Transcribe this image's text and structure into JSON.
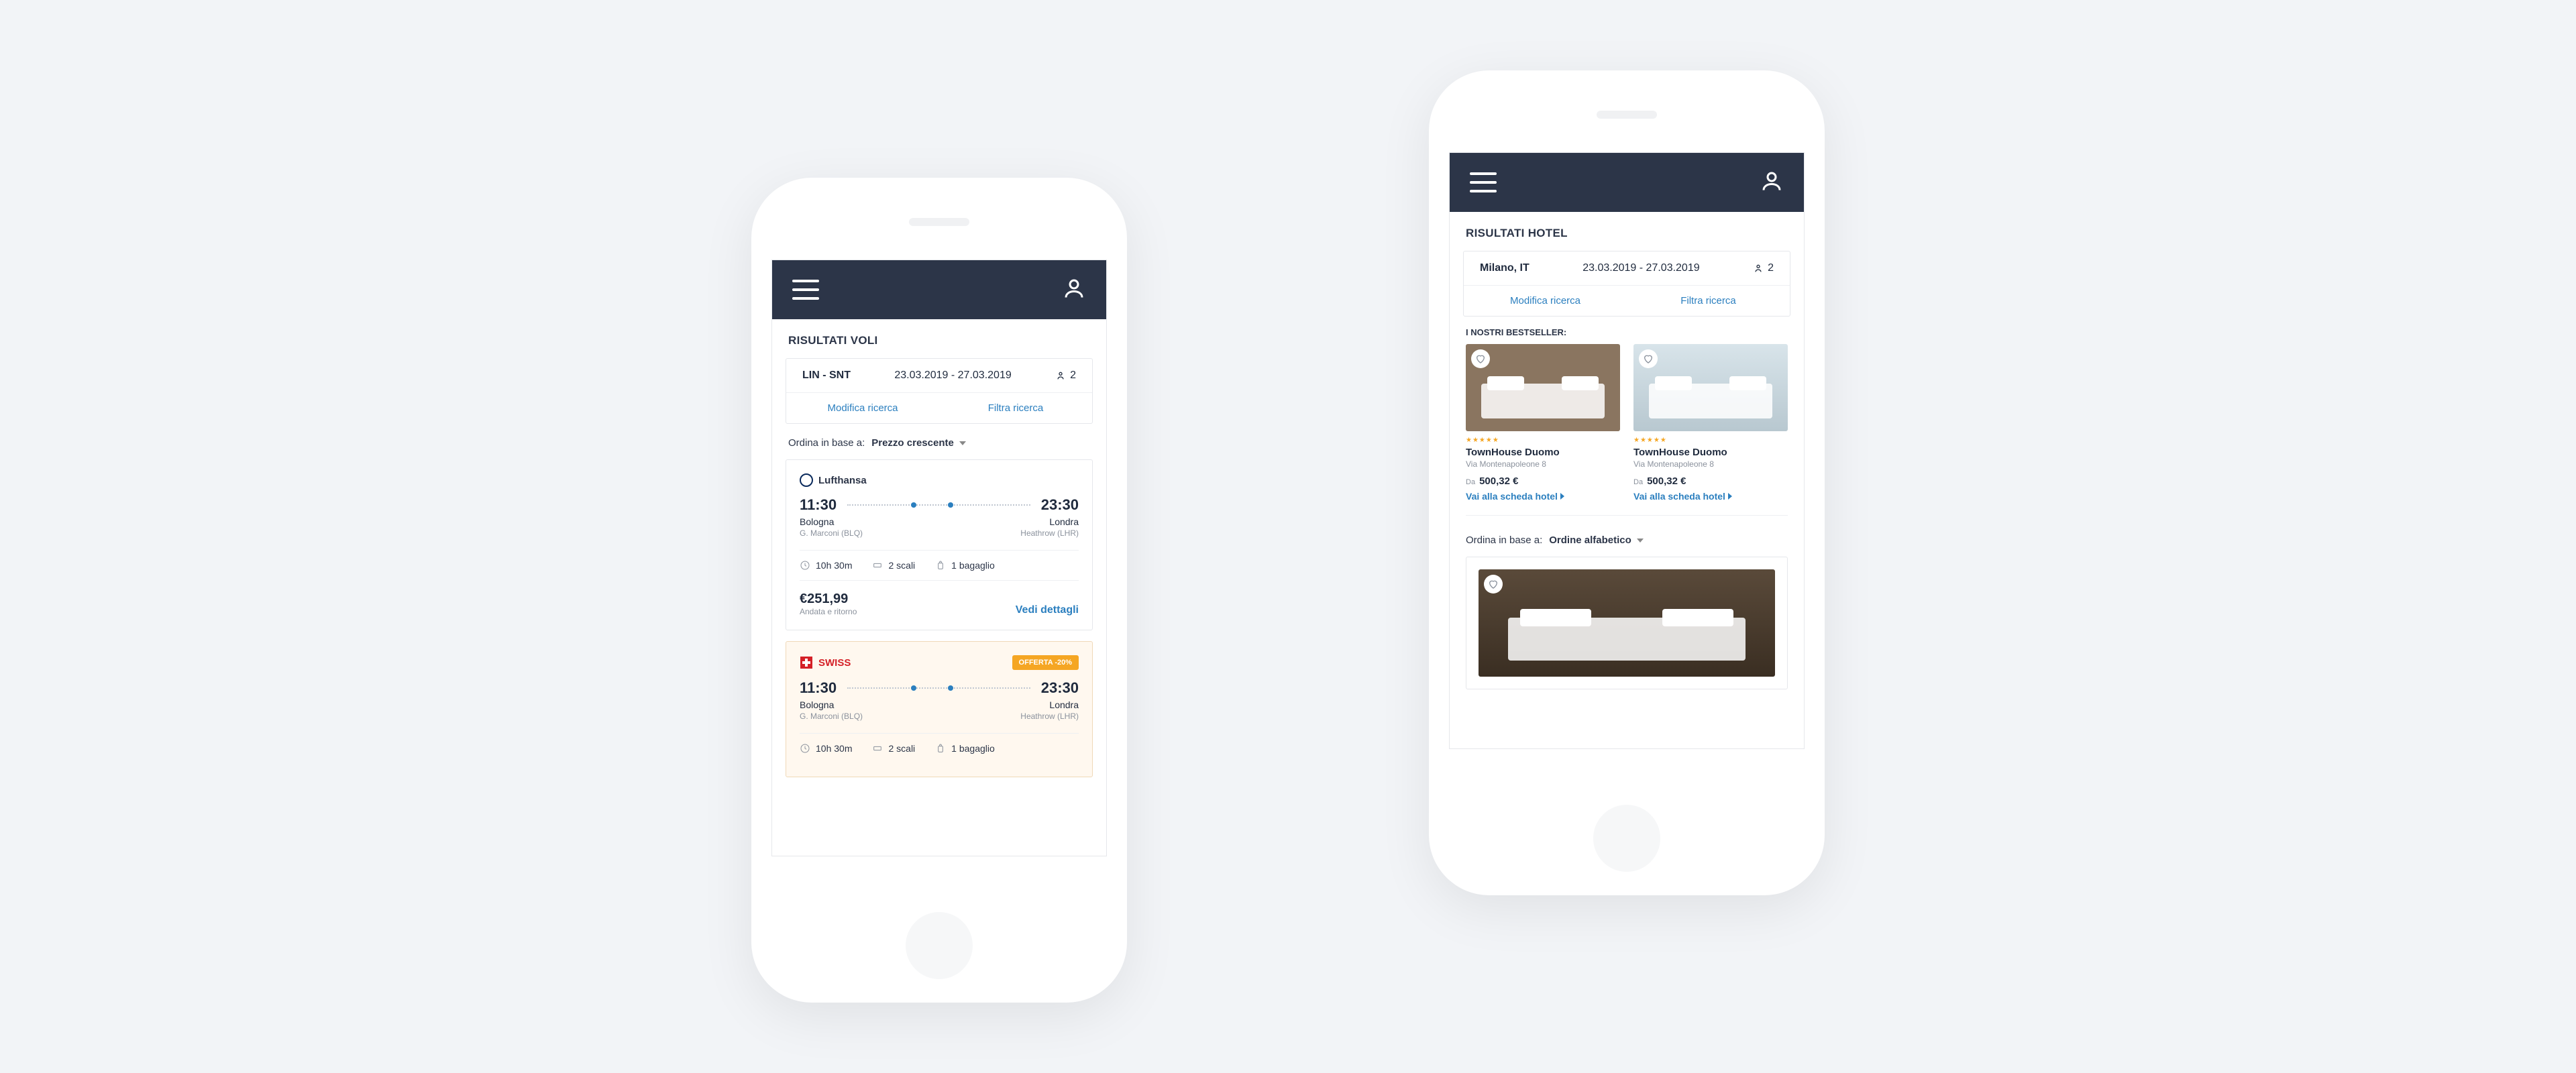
{
  "flights": {
    "section_title": "RISULTATI VOLI",
    "search": {
      "route": "LIN - SNT",
      "dates": "23.03.2019 - 27.03.2019",
      "guests": "2",
      "modify": "Modifica ricerca",
      "filter": "Filtra ricerca"
    },
    "sort_label": "Ordina in base a:",
    "sort_value": "Prezzo crescente",
    "cards": [
      {
        "airline": "Lufthansa",
        "dep_time": "11:30",
        "arr_time": "23:30",
        "dep_city": "Bologna",
        "arr_city": "Londra",
        "dep_code": "G. Marconi (BLQ)",
        "arr_code": "Heathrow (LHR)",
        "duration": "10h 30m",
        "stops": "2 scali",
        "baggage": "1 bagaglio",
        "price": "€251,99",
        "price_sub": "Andata e ritorno",
        "details": "Vedi dettagli"
      },
      {
        "airline": "SWISS",
        "offer_badge": "OFFERTA -20%",
        "dep_time": "11:30",
        "arr_time": "23:30",
        "dep_city": "Bologna",
        "arr_city": "Londra",
        "dep_code": "G. Marconi (BLQ)",
        "arr_code": "Heathrow (LHR)",
        "duration": "10h 30m",
        "stops": "2 scali",
        "baggage": "1 bagaglio"
      }
    ]
  },
  "hotels": {
    "section_title": "RISULTATI HOTEL",
    "search": {
      "location": "Milano, IT",
      "dates": "23.03.2019 - 27.03.2019",
      "guests": "2",
      "modify": "Modifica ricerca",
      "filter": "Filtra ricerca"
    },
    "bestseller_label": "I NOSTRI BESTSELLER:",
    "sort_label": "Ordina in base a:",
    "sort_value": "Ordine alfabetico",
    "bestsellers": [
      {
        "stars": "★★★★★",
        "name": "TownHouse Duomo",
        "address": "Via Montenapoleone 8",
        "from": "Da",
        "price": "500,32 €",
        "link": "Vai alla scheda hotel"
      },
      {
        "stars": "★★★★★",
        "name": "TownHouse Duomo",
        "address": "Via Montenapoleone 8",
        "from": "Da",
        "price": "500,32 €",
        "link": "Vai alla scheda hotel"
      }
    ]
  }
}
